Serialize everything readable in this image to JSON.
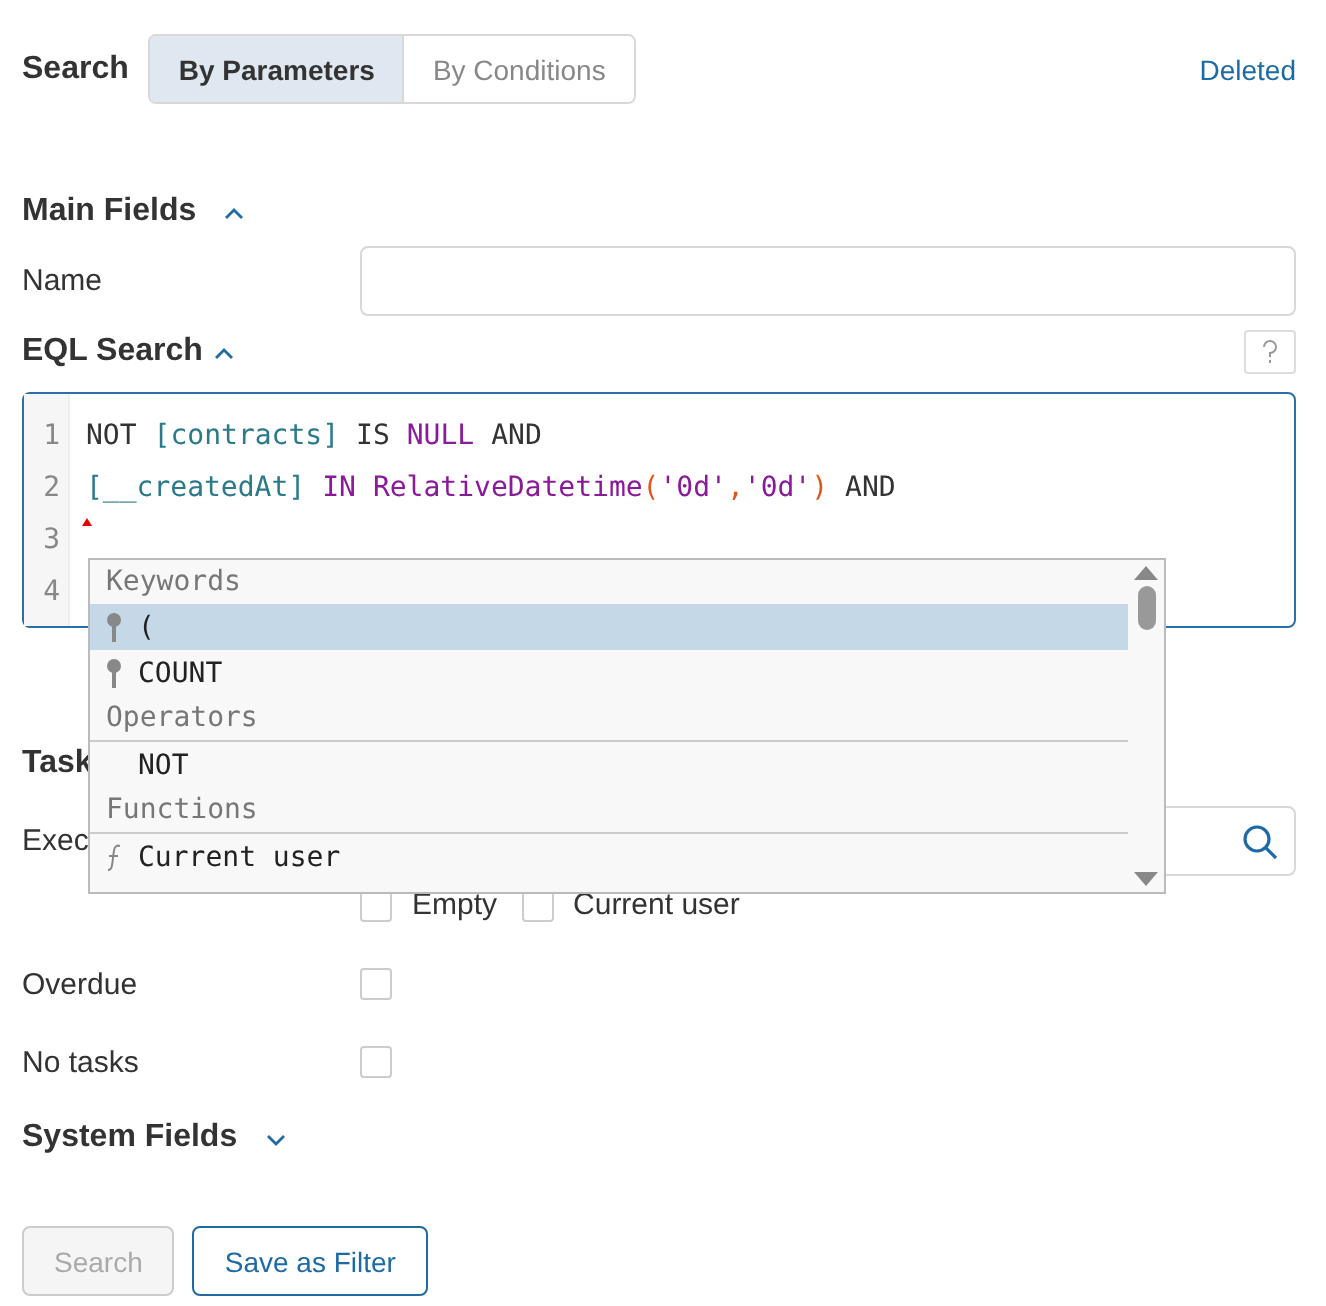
{
  "header": {
    "title": "Search",
    "tabs": [
      {
        "label": "By Parameters",
        "selected": true
      },
      {
        "label": "By Conditions",
        "selected": false
      }
    ],
    "link": "Deleted"
  },
  "main_fields": {
    "title": "Main Fields",
    "expanded": true,
    "name_label": "Name"
  },
  "eql": {
    "title": "EQL Search",
    "expanded": true,
    "lines": [
      {
        "number": "1",
        "tokens": [
          {
            "kind": "keyword",
            "text": "NOT"
          },
          {
            "kind": "field",
            "text": "[contracts]"
          },
          {
            "kind": "keyword",
            "text": "IS"
          },
          {
            "kind": "literal",
            "text": "NULL"
          },
          {
            "kind": "keyword",
            "text": "AND"
          }
        ]
      },
      {
        "number": "2",
        "tokens": [
          {
            "kind": "field",
            "text": "[__createdAt]"
          },
          {
            "kind": "literal",
            "text": "IN"
          },
          {
            "kind": "func",
            "text": "RelativeDatetime"
          },
          {
            "kind": "open",
            "text": "("
          },
          {
            "kind": "string",
            "text": "'0d'"
          },
          {
            "kind": "comma",
            "text": ","
          },
          {
            "kind": "string",
            "text": "'0d'"
          },
          {
            "kind": "close",
            "text": ")"
          },
          {
            "kind": "keyword",
            "text": "AND"
          }
        ]
      },
      {
        "number": "3",
        "cursor": true
      },
      {
        "number": "4"
      }
    ],
    "suggestions": [
      {
        "kind": "group",
        "text": "Keywords"
      },
      {
        "kind": "keyword",
        "text": "(",
        "selected": true
      },
      {
        "kind": "keyword",
        "text": "COUNT",
        "selected": false
      },
      {
        "kind": "group",
        "text": "Operators"
      },
      {
        "kind": "operator",
        "text": "NOT",
        "selected": false
      },
      {
        "kind": "group",
        "text": "Functions"
      },
      {
        "kind": "function",
        "text": "Current user",
        "selected": false
      }
    ]
  },
  "tasks": {
    "title": "Task",
    "executor_label": "Exec",
    "options": [
      {
        "label": "Empty",
        "checked": false
      },
      {
        "label": "Current user",
        "checked": false
      }
    ]
  },
  "flags": [
    {
      "label": "Overdue",
      "checked": false
    },
    {
      "label": "No tasks",
      "checked": false
    }
  ],
  "system_fields": {
    "title": "System Fields",
    "expanded": false
  },
  "buttons": [
    {
      "label": "Search",
      "disabled": true
    },
    {
      "label": "Save as Filter",
      "disabled": false
    }
  ]
}
